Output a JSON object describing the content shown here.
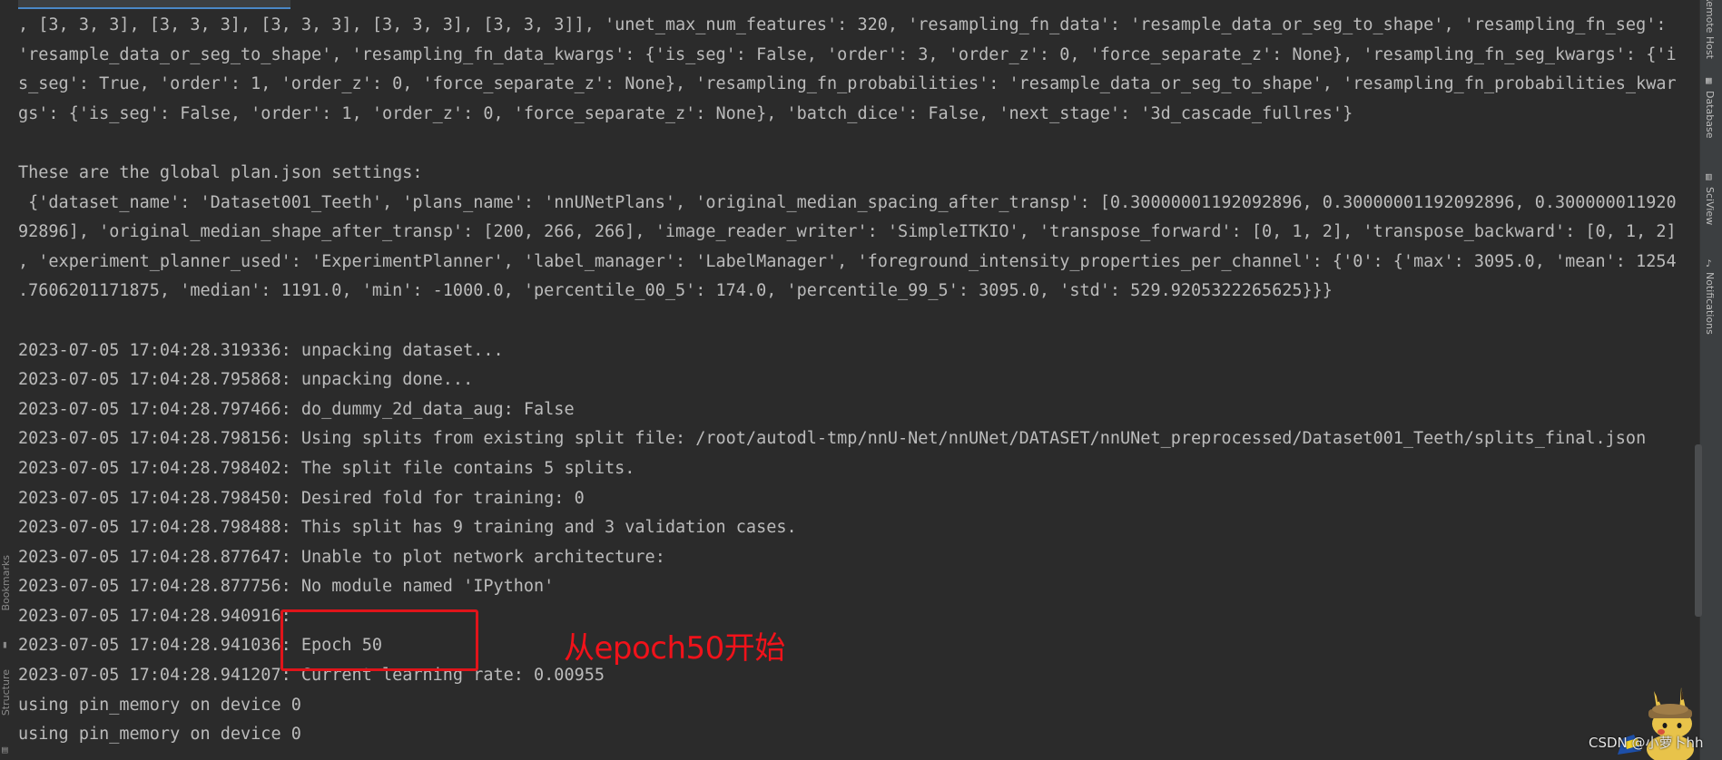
{
  "console": {
    "lines": [
      ", [3, 3, 3], [3, 3, 3], [3, 3, 3], [3, 3, 3], [3, 3, 3]], 'unet_max_num_features': 320, 'resampling_fn_data': 'resample_data_or_seg_to_shape', 'resampling_fn_seg':",
      "'resample_data_or_seg_to_shape', 'resampling_fn_data_kwargs': {'is_seg': False, 'order': 3, 'order_z': 0, 'force_separate_z': None}, 'resampling_fn_seg_kwargs': {'i",
      "s_seg': True, 'order': 1, 'order_z': 0, 'force_separate_z': None}, 'resampling_fn_probabilities': 'resample_data_or_seg_to_shape', 'resampling_fn_probabilities_kwar",
      "gs': {'is_seg': False, 'order': 1, 'order_z': 0, 'force_separate_z': None}, 'batch_dice': False, 'next_stage': '3d_cascade_fullres'}",
      "",
      "These are the global plan.json settings:",
      " {'dataset_name': 'Dataset001_Teeth', 'plans_name': 'nnUNetPlans', 'original_median_spacing_after_transp': [0.30000001192092896, 0.30000001192092896, 0.300000011920",
      "92896], 'original_median_shape_after_transp': [200, 266, 266], 'image_reader_writer': 'SimpleITKIO', 'transpose_forward': [0, 1, 2], 'transpose_backward': [0, 1, 2]",
      ", 'experiment_planner_used': 'ExperimentPlanner', 'label_manager': 'LabelManager', 'foreground_intensity_properties_per_channel': {'0': {'max': 3095.0, 'mean': 1254",
      ".7606201171875, 'median': 1191.0, 'min': -1000.0, 'percentile_00_5': 174.0, 'percentile_99_5': 3095.0, 'std': 529.9205322265625}}}",
      "",
      "2023-07-05 17:04:28.319336: unpacking dataset...",
      "2023-07-05 17:04:28.795868: unpacking done...",
      "2023-07-05 17:04:28.797466: do_dummy_2d_data_aug: False",
      "2023-07-05 17:04:28.798156: Using splits from existing split file: /root/autodl-tmp/nnU-Net/nnUNet/DATASET/nnUNet_preprocessed/Dataset001_Teeth/splits_final.json",
      "2023-07-05 17:04:28.798402: The split file contains 5 splits.",
      "2023-07-05 17:04:28.798450: Desired fold for training: 0",
      "2023-07-05 17:04:28.798488: This split has 9 training and 3 validation cases.",
      "2023-07-05 17:04:28.877647: Unable to plot network architecture:",
      "2023-07-05 17:04:28.877756: No module named 'IPython'",
      "2023-07-05 17:04:28.940916:",
      "2023-07-05 17:04:28.941036: Epoch 50",
      "2023-07-05 17:04:28.941207: Current learning rate: 0.00955",
      "using pin_memory on device 0",
      "using pin_memory on device 0"
    ]
  },
  "annotation": {
    "text": "从epoch50开始",
    "color": "#f1121a"
  },
  "left_toolbar": {
    "bookmarks": "Bookmarks",
    "structure": "Structure"
  },
  "right_toolbar": {
    "remote_host": "Remote Host",
    "database": "Database",
    "sciview": "SciView",
    "notifications": "Notifications"
  },
  "watermark": "CSDN @小萝卜hh",
  "colors": {
    "background": "#2b2b2b",
    "text": "#bbbbbb",
    "highlight_box": "#e0141a"
  },
  "icons": [
    "bookmark-icon",
    "structure-icon",
    "database-icon",
    "sciview-icon",
    "notifications-icon",
    "pikachu-mascot-icon"
  ]
}
